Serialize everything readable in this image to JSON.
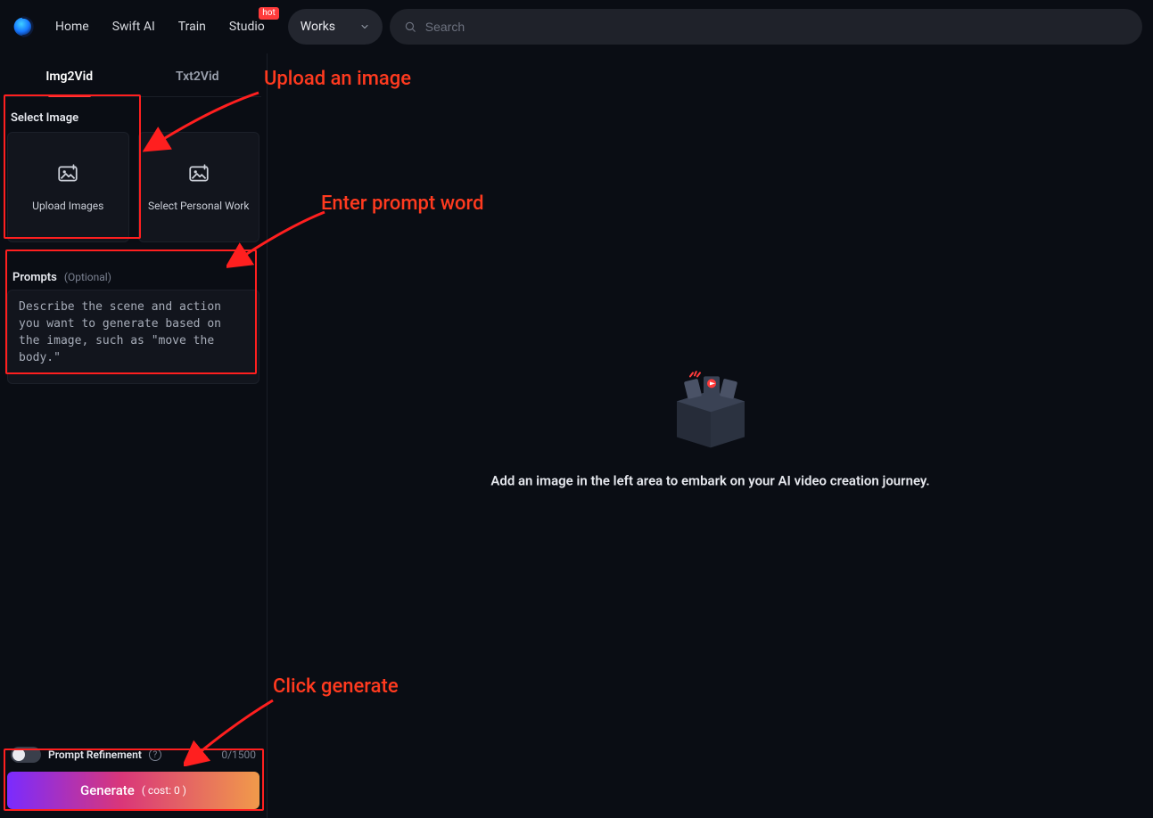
{
  "nav": {
    "items": [
      "Home",
      "Swift AI",
      "Train",
      "Studio"
    ],
    "hot_badge": "hot",
    "dropdown_label": "Works",
    "search_placeholder": "Search"
  },
  "tabs": {
    "img2vid": "Img2Vid",
    "txt2vid": "Txt2Vid"
  },
  "select_image": {
    "title": "Select Image",
    "tile_upload": "Upload Images",
    "tile_personal": "Select Personal Work"
  },
  "prompts": {
    "title": "Prompts",
    "optional": "(Optional)",
    "placeholder": "Describe the scene and action you want to generate based on the image, such as \"move the body.\""
  },
  "refine": {
    "label": "Prompt Refinement",
    "counter": "0/1500"
  },
  "generate": {
    "label": "Generate",
    "cost": "( cost: 0 )"
  },
  "empty_state": {
    "message": "Add an image in the left area to embark on your AI video creation journey."
  },
  "annotations": {
    "upload": "Upload an image",
    "prompt": "Enter prompt word",
    "generate": "Click generate"
  }
}
